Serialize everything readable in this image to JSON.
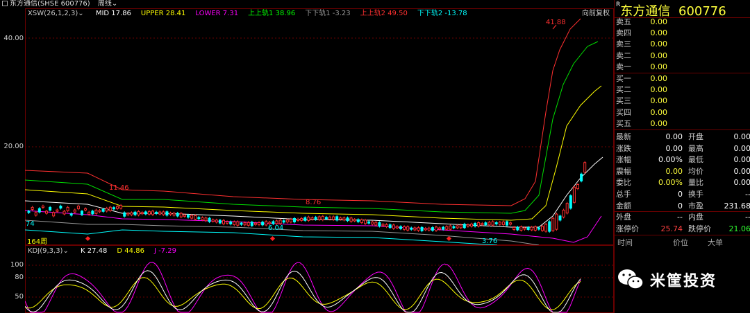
{
  "window": {
    "title": "东方通信(SHSE 600776)",
    "period": "周线"
  },
  "main_indicator": {
    "name": "XSW(26,1,2,3)",
    "items": [
      {
        "label": "MID 17.86",
        "color": "#ffffff"
      },
      {
        "label": "UPPER 28.41",
        "color": "#ffff00"
      },
      {
        "label": "LOWER 7.31",
        "color": "#ff00ff"
      },
      {
        "label": "上上轨1 38.96",
        "color": "#00ff00"
      },
      {
        "label": "下下轨1 -3.23",
        "color": "#999999"
      },
      {
        "label": "上上轨2 49.50",
        "color": "#ff3030"
      },
      {
        "label": "下下轨2 -13.78",
        "color": "#00ffff"
      }
    ],
    "adjust": "向前复权",
    "y_labels": [
      "40.00",
      "20.00"
    ],
    "annotations": {
      "high": "41.88",
      "peak1": "11.46",
      "peak2": "8.76",
      "low1": "6.04",
      "low2": "3.76",
      "left_low": "74"
    },
    "week_count": "164周"
  },
  "kdj": {
    "name": "KDJ(9,3,3)",
    "items": [
      {
        "label": "K 27.48",
        "color": "#ffffff"
      },
      {
        "label": "D 44.86",
        "color": "#ffff00"
      },
      {
        "label": "J -7.29",
        "color": "#ff00ff"
      }
    ],
    "y_labels": [
      "100",
      "80",
      "50"
    ]
  },
  "quote": {
    "prefix": "R",
    "name": "东方通信",
    "code": "600776",
    "ask": [
      {
        "label": "卖五",
        "price": "0.00"
      },
      {
        "label": "卖四",
        "price": "0.00"
      },
      {
        "label": "卖三",
        "price": "0.00"
      },
      {
        "label": "卖二",
        "price": "0.00"
      },
      {
        "label": "卖一",
        "price": "0.00"
      }
    ],
    "bid": [
      {
        "label": "买一",
        "price": "0.00"
      },
      {
        "label": "买二",
        "price": "0.00"
      },
      {
        "label": "买三",
        "price": "0.00"
      },
      {
        "label": "买四",
        "price": "0.00"
      },
      {
        "label": "买五",
        "price": "0.00"
      }
    ],
    "stats": [
      {
        "l1": "最新",
        "v1": "0.00",
        "l2": "开盘",
        "v2": "0.00"
      },
      {
        "l1": "涨跌",
        "v1": "0.00",
        "l2": "最高",
        "v2": "0.00"
      },
      {
        "l1": "涨幅",
        "v1": "0.00%",
        "l2": "最低",
        "v2": "0.00"
      },
      {
        "l1": "震幅",
        "v1": "0.00",
        "l2": "均价",
        "v2": "0.00"
      },
      {
        "l1": "委比",
        "v1": "0.00%",
        "l2": "量比",
        "v2": "0.00"
      },
      {
        "l1": "总手",
        "v1": "0",
        "l2": "换手",
        "v2": "--"
      },
      {
        "l1": "金额",
        "v1": "0",
        "l2": "市盈",
        "v2": "231.68"
      },
      {
        "l1": "外盘",
        "v1": "--",
        "l2": "内盘",
        "v2": "--"
      },
      {
        "l1": "涨停价",
        "v1": "25.74",
        "l2": "跌停价",
        "v2": "21.06"
      }
    ],
    "ticks_header": [
      "时间",
      "价位",
      "大单"
    ]
  },
  "watermark": {
    "text": "米筐投资"
  }
}
